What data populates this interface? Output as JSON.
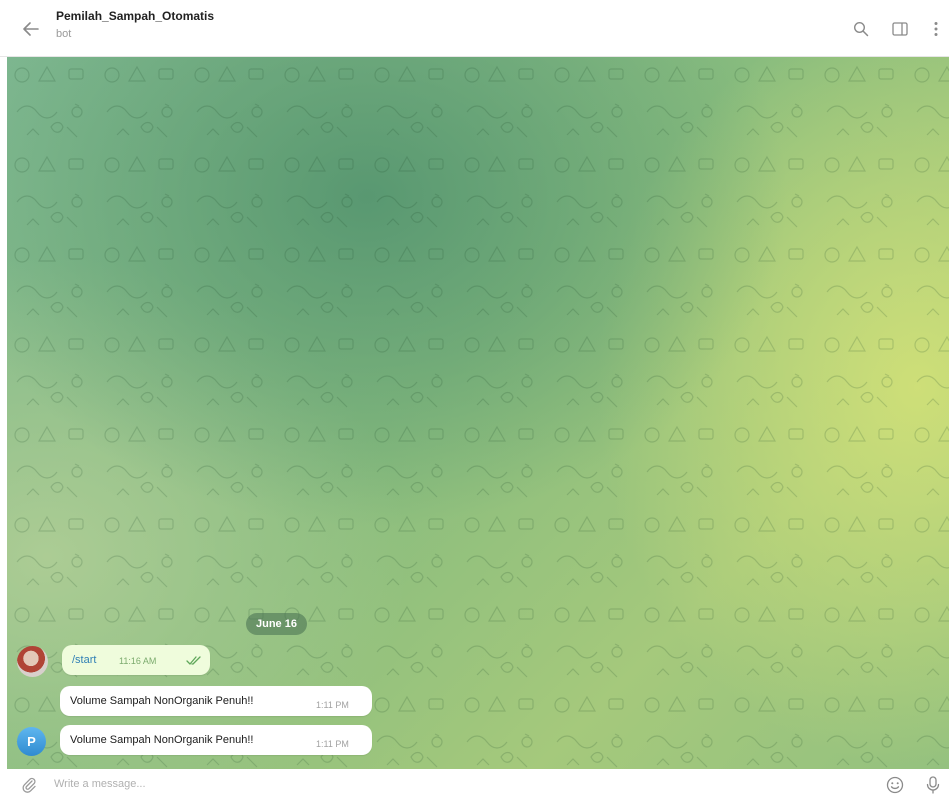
{
  "chat": {
    "title": "Pemilah_Sampah_Otomatis",
    "subtitle": "bot"
  },
  "date_separator": "June 16",
  "messages": [
    {
      "text": "/start",
      "time": "11:16 AM",
      "outgoing": true
    },
    {
      "text": "Volume Sampah NonOrganik Penuh!!",
      "time": "1:11 PM",
      "outgoing": false
    },
    {
      "text": "Volume Sampah NonOrganik Penuh!!",
      "time": "1:11 PM",
      "outgoing": false
    }
  ],
  "bot_avatar_letter": "P",
  "composer": {
    "placeholder": "Write a message..."
  },
  "colors": {
    "outgoing_bubble": "#effcdc",
    "incoming_bubble": "#ffffff",
    "bot_avatar": "#3a98dc",
    "date_pill": "#5f8a6a"
  },
  "icons": [
    "back-arrow-icon",
    "search-icon",
    "sidebar-toggle-icon",
    "more-vertical-icon",
    "paperclip-icon",
    "emoji-icon",
    "microphone-icon",
    "double-check-icon"
  ]
}
